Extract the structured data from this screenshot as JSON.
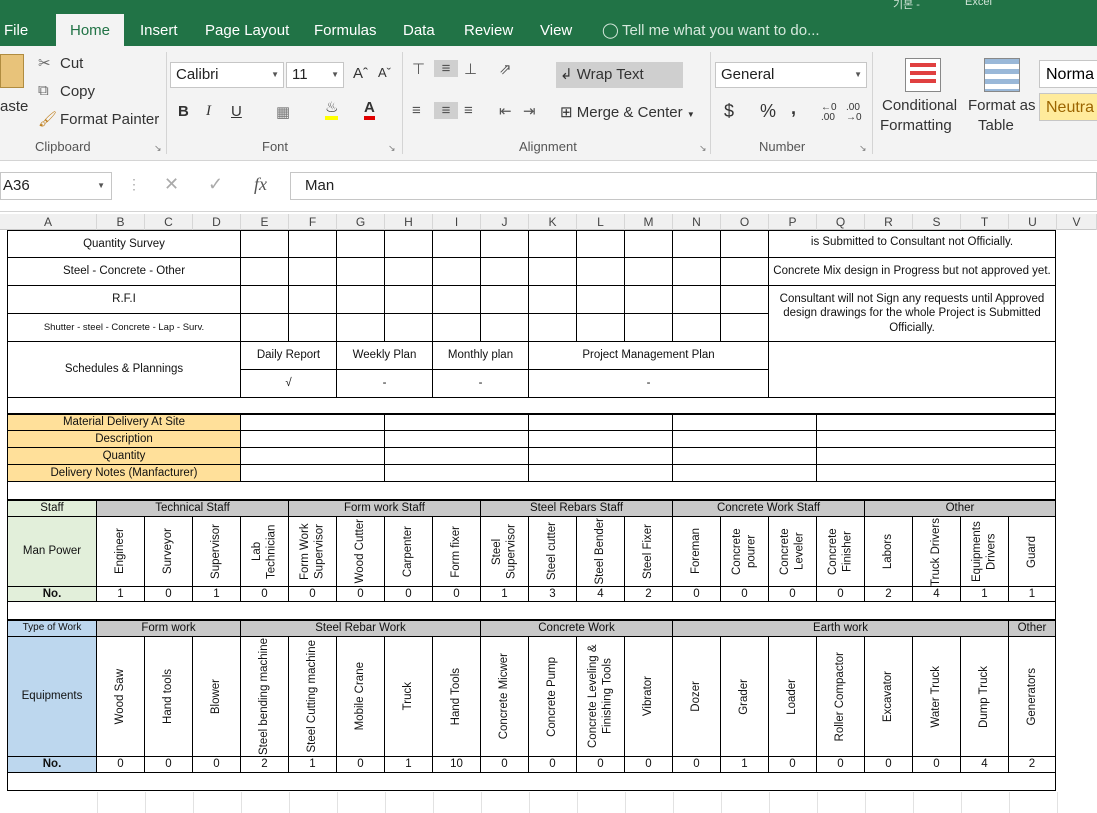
{
  "app": {
    "title_suffix": "Excel",
    "title_cjk": "기본 -"
  },
  "menu": {
    "tabs": [
      "File",
      "Home",
      "Insert",
      "Page Layout",
      "Formulas",
      "Data",
      "Review",
      "View"
    ],
    "tell_me": "Tell me what you want to do..."
  },
  "ribbon": {
    "clipboard": {
      "paste": "aste",
      "cut": "Cut",
      "copy": "Copy",
      "format_painter": "Format Painter",
      "label": "Clipboard"
    },
    "font": {
      "name": "Calibri",
      "size": "11",
      "bold": "B",
      "italic": "I",
      "underline": "U",
      "label": "Font"
    },
    "alignment": {
      "wrap_text": "Wrap Text",
      "merge_center": "Merge & Center",
      "label": "Alignment"
    },
    "number": {
      "format": "General",
      "currency": "$",
      "percent": "%",
      "comma": ",",
      "label": "Number"
    },
    "styles": {
      "conditional": "Conditional",
      "formatting": "Formatting",
      "format_as": "Format as",
      "table": "Table",
      "normal": "Norma",
      "neutral": "Neutra"
    }
  },
  "formula_bar": {
    "name_box": "A36",
    "formula": "Man"
  },
  "columns": [
    "A",
    "B",
    "C",
    "D",
    "E",
    "F",
    "G",
    "H",
    "I",
    "J",
    "K",
    "L",
    "M",
    "N",
    "O",
    "P",
    "Q",
    "R",
    "S",
    "T",
    "U",
    "V"
  ],
  "sheet": {
    "top_rows": [
      "Quantity Survey",
      "Steel - Concrete - Other",
      "R.F.I",
      "Shutter - steel - Concrete - Lap - Surv."
    ],
    "notes": [
      "is Submitted to Consultant not Officially.",
      "Concrete Mix design in Progress but not approved yet.",
      "Consultant will not Sign any requests until Approved design drawings for the whole Project is Submitted Officially."
    ],
    "schedules": {
      "label": "Schedules & Plannings",
      "headers": [
        "Daily Report",
        "Weekly Plan",
        "Monthly plan",
        "Project Management Plan"
      ],
      "values": [
        "√",
        "-",
        "-",
        "-"
      ]
    },
    "material": [
      "Material Delivery At Site",
      "Description",
      "Quantity",
      "Delivery Notes (Manfacturer)"
    ],
    "staff": {
      "label": "Staff",
      "manpower": "Man Power",
      "no": "No.",
      "groups": [
        "Technical Staff",
        "Form work Staff",
        "Steel Rebars Staff",
        "Concrete Work Staff",
        "Other"
      ],
      "roles": [
        "Engineer",
        "Surveyor",
        "Supervisor",
        "Lab Technician",
        "Form Work Supervisor",
        "Wood Cutter",
        "Carpenter",
        "Form fixer",
        "Steel Supervisor",
        "Steel cutter",
        "Steel Bender",
        "Steel Fixer",
        "Foreman",
        "Concrete pourer",
        "Concrete Leveler",
        "Concrete Finisher",
        "Labors",
        "Truck Drivers",
        "Equipments Drivers",
        "Guard"
      ],
      "counts": [
        "1",
        "0",
        "1",
        "0",
        "0",
        "0",
        "0",
        "0",
        "1",
        "3",
        "4",
        "2",
        "0",
        "0",
        "0",
        "0",
        "2",
        "4",
        "1",
        "1"
      ]
    },
    "equipment": {
      "label": "Type of Work",
      "equipments": "Equipments",
      "no": "No.",
      "groups": [
        "Form work",
        "Steel Rebar Work",
        "Concrete Work",
        "Earth work",
        "Other"
      ],
      "items": [
        "Wood Saw",
        "Hand tools",
        "Blower",
        "Steel bending machine",
        "Steel Cutting machine",
        "Mobile Crane",
        "Truck",
        "Hand Tools",
        "Concrete Micwer",
        "Concrete Pump",
        "Concrete Leveling & Finishing Tools",
        "Vibrator",
        "Dozer",
        "Grader",
        "Loader",
        "Roller Compactor",
        "Excavator",
        "Water Truck",
        "Dump Truck",
        "Generators"
      ],
      "counts": [
        "0",
        "0",
        "0",
        "2",
        "1",
        "0",
        "1",
        "10",
        "0",
        "0",
        "0",
        "0",
        "0",
        "1",
        "0",
        "0",
        "0",
        "0",
        "4",
        "2"
      ]
    }
  }
}
